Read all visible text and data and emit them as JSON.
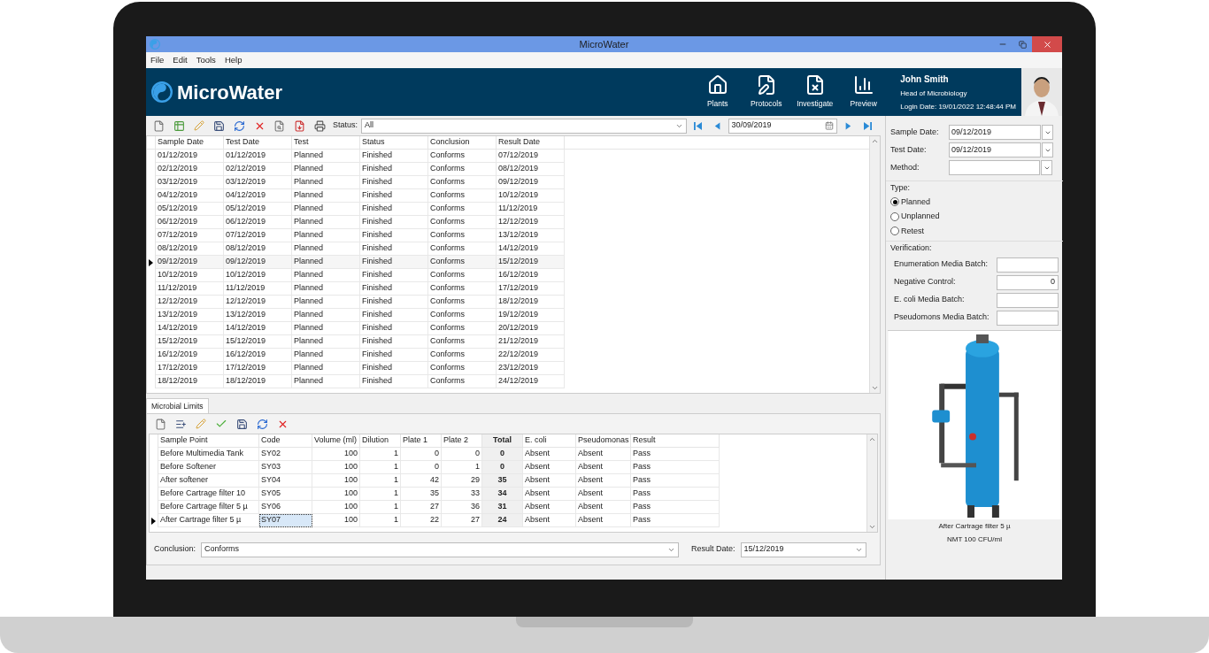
{
  "window": {
    "title": "MicroWater"
  },
  "menu": [
    "File",
    "Edit",
    "Tools",
    "Help"
  ],
  "header": {
    "app_name": "MicroWater",
    "nav": [
      {
        "label": "Plants",
        "kind": "home"
      },
      {
        "label": "Protocols",
        "kind": "edit"
      },
      {
        "label": "Investigate",
        "kind": "cancel"
      },
      {
        "label": "Preview",
        "kind": "chart"
      }
    ],
    "user": {
      "name": "John Smith",
      "role": "Head of Microbiology",
      "login": "Login Date:  19/01/2022 12:48:44 PM"
    }
  },
  "toolbar": {
    "status_label": "Status:",
    "status_value": "All",
    "date": "30/09/2019"
  },
  "samples": {
    "columns": [
      "Sample Date",
      "Test Date",
      "Test",
      "Status",
      "Conclusion",
      "Result Date"
    ],
    "rows": [
      {
        "cells": [
          "01/12/2019",
          "01/12/2019",
          "Planned",
          "Finished",
          "Conforms",
          "07/12/2019"
        ],
        "selected": false
      },
      {
        "cells": [
          "02/12/2019",
          "02/12/2019",
          "Planned",
          "Finished",
          "Conforms",
          "08/12/2019"
        ],
        "selected": false
      },
      {
        "cells": [
          "03/12/2019",
          "03/12/2019",
          "Planned",
          "Finished",
          "Conforms",
          "09/12/2019"
        ],
        "selected": false
      },
      {
        "cells": [
          "04/12/2019",
          "04/12/2019",
          "Planned",
          "Finished",
          "Conforms",
          "10/12/2019"
        ],
        "selected": false
      },
      {
        "cells": [
          "05/12/2019",
          "05/12/2019",
          "Planned",
          "Finished",
          "Conforms",
          "11/12/2019"
        ],
        "selected": false
      },
      {
        "cells": [
          "06/12/2019",
          "06/12/2019",
          "Planned",
          "Finished",
          "Conforms",
          "12/12/2019"
        ],
        "selected": false
      },
      {
        "cells": [
          "07/12/2019",
          "07/12/2019",
          "Planned",
          "Finished",
          "Conforms",
          "13/12/2019"
        ],
        "selected": false
      },
      {
        "cells": [
          "08/12/2019",
          "08/12/2019",
          "Planned",
          "Finished",
          "Conforms",
          "14/12/2019"
        ],
        "selected": false
      },
      {
        "cells": [
          "09/12/2019",
          "09/12/2019",
          "Planned",
          "Finished",
          "Conforms",
          "15/12/2019"
        ],
        "selected": true
      },
      {
        "cells": [
          "10/12/2019",
          "10/12/2019",
          "Planned",
          "Finished",
          "Conforms",
          "16/12/2019"
        ],
        "selected": false
      },
      {
        "cells": [
          "11/12/2019",
          "11/12/2019",
          "Planned",
          "Finished",
          "Conforms",
          "17/12/2019"
        ],
        "selected": false
      },
      {
        "cells": [
          "12/12/2019",
          "12/12/2019",
          "Planned",
          "Finished",
          "Conforms",
          "18/12/2019"
        ],
        "selected": false
      },
      {
        "cells": [
          "13/12/2019",
          "13/12/2019",
          "Planned",
          "Finished",
          "Conforms",
          "19/12/2019"
        ],
        "selected": false
      },
      {
        "cells": [
          "14/12/2019",
          "14/12/2019",
          "Planned",
          "Finished",
          "Conforms",
          "20/12/2019"
        ],
        "selected": false
      },
      {
        "cells": [
          "15/12/2019",
          "15/12/2019",
          "Planned",
          "Finished",
          "Conforms",
          "21/12/2019"
        ],
        "selected": false
      },
      {
        "cells": [
          "16/12/2019",
          "16/12/2019",
          "Planned",
          "Finished",
          "Conforms",
          "22/12/2019"
        ],
        "selected": false
      },
      {
        "cells": [
          "17/12/2019",
          "17/12/2019",
          "Planned",
          "Finished",
          "Conforms",
          "23/12/2019"
        ],
        "selected": false
      },
      {
        "cells": [
          "18/12/2019",
          "18/12/2019",
          "Planned",
          "Finished",
          "Conforms",
          "24/12/2019"
        ],
        "selected": false
      }
    ]
  },
  "tab": {
    "label": "Microbial Limits",
    "selected": true
  },
  "limits": {
    "columns": [
      {
        "label": "Sample Point",
        "kind": "text"
      },
      {
        "label": "Code",
        "kind": "text"
      },
      {
        "label": "Volume (ml)",
        "kind": "number"
      },
      {
        "label": "Dilution",
        "kind": "number"
      },
      {
        "label": "Plate 1",
        "kind": "number"
      },
      {
        "label": "Plate 2",
        "kind": "number"
      },
      {
        "label": "Total",
        "kind": "total"
      },
      {
        "label": "E. coli",
        "kind": "text"
      },
      {
        "label": "Pseudomonas",
        "kind": "text"
      },
      {
        "label": "Result",
        "kind": "text"
      }
    ],
    "rows": [
      {
        "cells": [
          "Before Multimedia Tank",
          "SY02",
          "100",
          "1",
          "0",
          "0",
          "0",
          "Absent",
          "Absent",
          "Pass"
        ],
        "selected": false
      },
      {
        "cells": [
          "Before Softener",
          "SY03",
          "100",
          "1",
          "0",
          "1",
          "0",
          "Absent",
          "Absent",
          "Pass"
        ],
        "selected": false
      },
      {
        "cells": [
          "After softener",
          "SY04",
          "100",
          "1",
          "42",
          "29",
          "35",
          "Absent",
          "Absent",
          "Pass"
        ],
        "selected": false
      },
      {
        "cells": [
          "Before Cartrage filter 10",
          "SY05",
          "100",
          "1",
          "35",
          "33",
          "34",
          "Absent",
          "Absent",
          "Pass"
        ],
        "selected": false
      },
      {
        "cells": [
          "Before Cartrage filter 5 µ",
          "SY06",
          "100",
          "1",
          "27",
          "36",
          "31",
          "Absent",
          "Absent",
          "Pass"
        ],
        "selected": false
      },
      {
        "cells": [
          "After Cartrage filter 5 µ",
          "SY07",
          "100",
          "1",
          "22",
          "27",
          "24",
          "Absent",
          "Absent",
          "Pass"
        ],
        "selected": true
      }
    ]
  },
  "conclusion": {
    "label": "Conclusion:",
    "value": "Conforms"
  },
  "result_date": {
    "label": "Result Date:",
    "value": "15/12/2019"
  },
  "details": {
    "fields": [
      {
        "label": "Sample Date:",
        "value": "09/12/2019"
      },
      {
        "label": "Test Date:",
        "value": "09/12/2019"
      },
      {
        "label": "Method:"
      }
    ]
  },
  "type": {
    "label": "Type:",
    "options": [
      {
        "label": "Planned",
        "selected": true
      },
      {
        "label": "Unplanned",
        "selected": false
      },
      {
        "label": "Retest",
        "selected": false
      }
    ]
  },
  "verification": {
    "label": "Verification:",
    "fields": [
      {
        "label": "Enumeration Media Batch:"
      },
      {
        "label": "Negative Control:",
        "value": "0"
      },
      {
        "label": "E. coli Media Batch:"
      },
      {
        "label": "Pseudomons Media Batch:"
      }
    ]
  },
  "picture_caption": [
    "After Cartrage filter 5 µ",
    "NMT 100 CFU/ml"
  ]
}
